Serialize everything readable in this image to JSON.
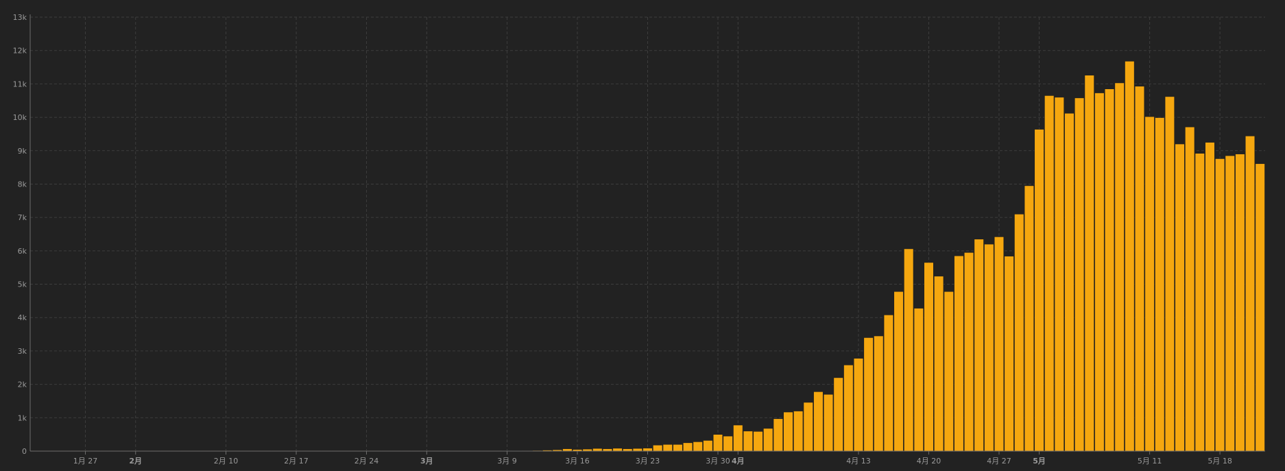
{
  "chart_data": {
    "type": "bar",
    "title": "",
    "xlabel": "",
    "ylabel": "",
    "ylim": [
      0,
      13000
    ],
    "grid": true,
    "colors": {
      "background": "#222222",
      "bar": "#f5a70f",
      "bar_stroke": "#1e1e1e",
      "grid": "#3d3d3d",
      "axis": "#6e6e6e",
      "tick_label": "#9a9a9a"
    },
    "y_ticks": [
      {
        "value": 0,
        "label": "0"
      },
      {
        "value": 1000,
        "label": "1k"
      },
      {
        "value": 2000,
        "label": "2k"
      },
      {
        "value": 3000,
        "label": "3k"
      },
      {
        "value": 4000,
        "label": "4k"
      },
      {
        "value": 5000,
        "label": "5k"
      },
      {
        "value": 6000,
        "label": "6k"
      },
      {
        "value": 7000,
        "label": "7k"
      },
      {
        "value": 8000,
        "label": "8k"
      },
      {
        "value": 9000,
        "label": "9k"
      },
      {
        "value": 10000,
        "label": "10k"
      },
      {
        "value": 11000,
        "label": "11k"
      },
      {
        "value": 12000,
        "label": "12k"
      },
      {
        "value": 13000,
        "label": "13k"
      }
    ],
    "x_ticks": [
      {
        "index": 5,
        "label": "1月 27",
        "bold": false
      },
      {
        "index": 10,
        "label": "2月",
        "bold": true
      },
      {
        "index": 19,
        "label": "2月 10",
        "bold": false
      },
      {
        "index": 26,
        "label": "2月 17",
        "bold": false
      },
      {
        "index": 33,
        "label": "2月 24",
        "bold": false
      },
      {
        "index": 39,
        "label": "3月",
        "bold": true
      },
      {
        "index": 47,
        "label": "3月 9",
        "bold": false
      },
      {
        "index": 54,
        "label": "3月 16",
        "bold": false
      },
      {
        "index": 61,
        "label": "3月 23",
        "bold": false
      },
      {
        "index": 68,
        "label": "3月 30",
        "bold": false
      },
      {
        "index": 70,
        "label": "4月",
        "bold": true
      },
      {
        "index": 82,
        "label": "4月 13",
        "bold": false
      },
      {
        "index": 89,
        "label": "4月 20",
        "bold": false
      },
      {
        "index": 96,
        "label": "4月 27",
        "bold": false
      },
      {
        "index": 100,
        "label": "5月",
        "bold": true
      },
      {
        "index": 111,
        "label": "5月 11",
        "bold": false
      },
      {
        "index": 118,
        "label": "5月 18",
        "bold": false
      }
    ],
    "values": [
      1,
      1,
      1,
      1,
      2,
      2,
      2,
      2,
      3,
      3,
      3,
      3,
      3,
      3,
      3,
      4,
      4,
      4,
      4,
      4,
      5,
      5,
      5,
      5,
      5,
      6,
      6,
      6,
      6,
      6,
      7,
      7,
      7,
      7,
      8,
      8,
      8,
      8,
      8,
      9,
      9,
      10,
      10,
      11,
      11,
      12,
      13,
      14,
      16,
      17,
      20,
      30,
      40,
      70,
      50,
      60,
      80,
      70,
      85,
      70,
      80,
      90,
      180,
      200,
      200,
      250,
      280,
      320,
      500,
      450,
      780,
      600,
      590,
      680,
      970,
      1170,
      1200,
      1460,
      1780,
      1700,
      2200,
      2580,
      2780,
      3400,
      3450,
      4080,
      4780,
      6060,
      4280,
      5650,
      5240,
      4780,
      5850,
      5950,
      6350,
      6200,
      6420,
      5840,
      7100,
      7950,
      9640,
      10650,
      10600,
      10120,
      10580,
      11260,
      10730,
      10850,
      11030,
      11680,
      10930,
      10020,
      9990,
      10620,
      9200,
      9710,
      8920,
      9250,
      8760,
      8850,
      8900,
      9440,
      8610
    ]
  }
}
